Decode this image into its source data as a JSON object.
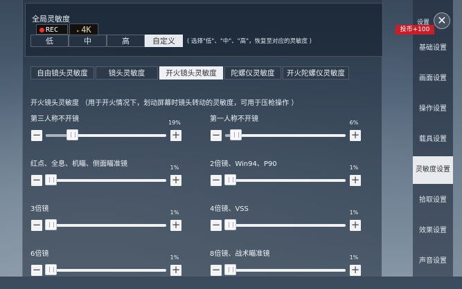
{
  "global": {
    "title": "全局灵敏度",
    "rec_label": "REC",
    "k4_label": "4K",
    "presets": [
      "低",
      "中",
      "高",
      "自定义"
    ],
    "active_preset_index": 3,
    "hint": "( 选择\"低\"、\"中\"、\"高\"，恢复至对应的灵敏度 )"
  },
  "tabs": [
    {
      "label": "自由镜头灵敏度",
      "active": false
    },
    {
      "label": "镜头灵敏度",
      "active": false
    },
    {
      "label": "开火镜头灵敏度",
      "active": true
    },
    {
      "label": "陀螺仪灵敏度",
      "active": false
    },
    {
      "label": "开火陀螺仪灵敏度",
      "active": false
    }
  ],
  "description": "开火镜头灵敏度 （用于开火情况下，划动屏幕时镜头转动的灵敏度，可用于压枪操作 ）",
  "sliders": [
    {
      "label": "第三人称不开镜",
      "value": "19%",
      "level": 0.19
    },
    {
      "label": "第一人称不开镜",
      "value": "6%",
      "level": 0.06
    },
    {
      "label": "红点、全息、机瞄、侧面瞄准镜",
      "value": "1%",
      "level": 0.01
    },
    {
      "label": "2倍镜、Win94、P90",
      "value": "1%",
      "level": 0.01
    },
    {
      "label": "3倍镜",
      "value": "1%",
      "level": 0.01
    },
    {
      "label": "4倍镜、VSS",
      "value": "1%",
      "level": 0.01
    },
    {
      "label": "6倍镜",
      "value": "1%",
      "level": 0.01
    },
    {
      "label": "8倍镜、战术瞄准镜",
      "value": "1%",
      "level": 0.01
    }
  ],
  "slider_minus": "−",
  "slider_plus": "+",
  "side": {
    "settings_label": "设置",
    "close_glyph": "✕",
    "coin_badge": "投币+100",
    "items": [
      {
        "label": "基础设置",
        "active": false
      },
      {
        "label": "画面设置",
        "active": false
      },
      {
        "label": "操作设置",
        "active": false
      },
      {
        "label": "载具设置",
        "active": false
      },
      {
        "label": "灵敏度设置",
        "active": true
      },
      {
        "label": "拾取设置",
        "active": false
      },
      {
        "label": "效果设置",
        "active": false
      },
      {
        "label": "声音设置",
        "active": false
      }
    ]
  },
  "colors": {
    "accent_red": "#c81e2a",
    "active_tab": "#eef0f3"
  }
}
